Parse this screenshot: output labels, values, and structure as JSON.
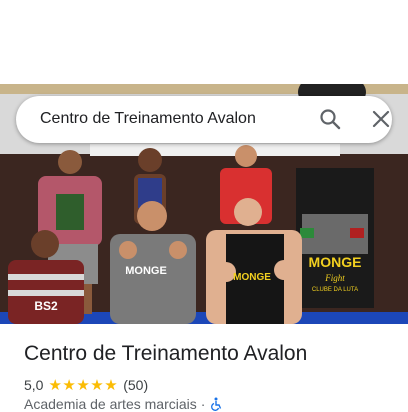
{
  "search": {
    "query": "Centro de Treinamento Avalon"
  },
  "icons": {
    "search": "search-icon",
    "close": "close-icon",
    "accessibility": "wheelchair-icon"
  },
  "photo": {
    "banner_text": "MONGE",
    "banner_subtext": "Fight",
    "banner_caption": "CLUBE DA LUTA",
    "shirt_center": "MONGE",
    "shirt_right": "MONGE",
    "shirt_left": "BS2"
  },
  "place": {
    "title": "Centro de Treinamento Avalon",
    "rating": "5,0",
    "stars": "★★★★★",
    "reviews": "(50)",
    "category": "Academia de artes marciais",
    "separator": "·"
  },
  "colors": {
    "star": "#fbbc04",
    "accent_blue": "#1a73e8"
  }
}
